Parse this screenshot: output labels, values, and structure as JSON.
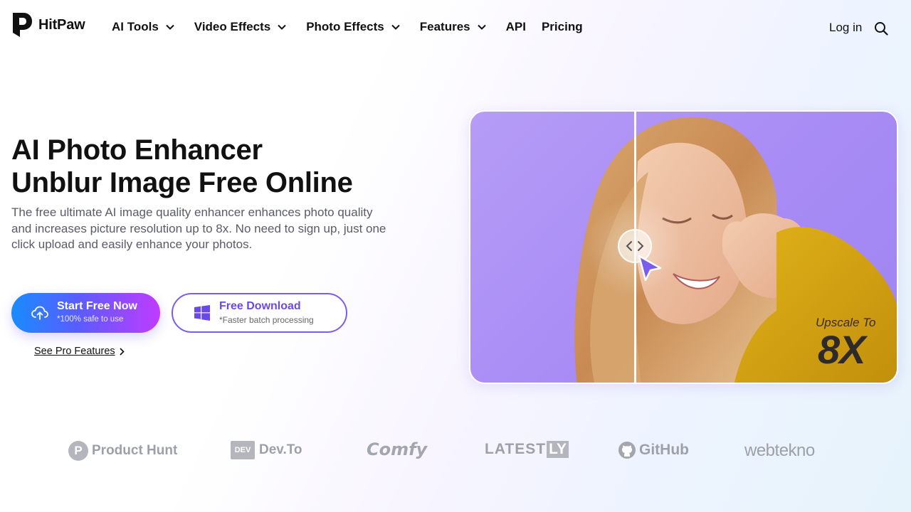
{
  "brand": {
    "name": "HitPaw"
  },
  "nav": {
    "items": [
      {
        "label": "AI Tools",
        "has_dropdown": true
      },
      {
        "label": "Video Effects",
        "has_dropdown": true
      },
      {
        "label": "Photo Effects",
        "has_dropdown": true
      },
      {
        "label": "Features",
        "has_dropdown": true
      },
      {
        "label": "API",
        "has_dropdown": false
      },
      {
        "label": "Pricing",
        "has_dropdown": false
      }
    ],
    "login_label": "Log in",
    "search_icon": "search-icon"
  },
  "hero": {
    "title_line1": "AI Photo Enhancer",
    "title_line2": "Unblur Image Free Online",
    "description": "The free ultimate AI image quality enhancer enhances photo quality and increases picture resolution up to 8x. No need to sign up, just one click upload and easily enhance your photos.",
    "start_button": {
      "label": "Start Free Now",
      "sub": "*100% safe to use",
      "icon": "upload-cloud-icon"
    },
    "download_button": {
      "label": "Free Download",
      "sub": "*Faster batch processing",
      "icon": "windows-icon"
    },
    "pro_link": "See Pro Features"
  },
  "showcase": {
    "upscale_label": "Upscale To",
    "upscale_value": "8X",
    "compare_handle_icon": "compare-arrows-icon"
  },
  "press_logos": [
    "Product Hunt",
    "Dev.To",
    "Comfy",
    "LATEST",
    "LY",
    "GitHub",
    "webtekno"
  ],
  "colors": {
    "accent_purple": "#7b5cf0",
    "gradient_start": "#1a8cff",
    "gradient_end": "#c13bff",
    "card_bg": "#b69cf7"
  }
}
